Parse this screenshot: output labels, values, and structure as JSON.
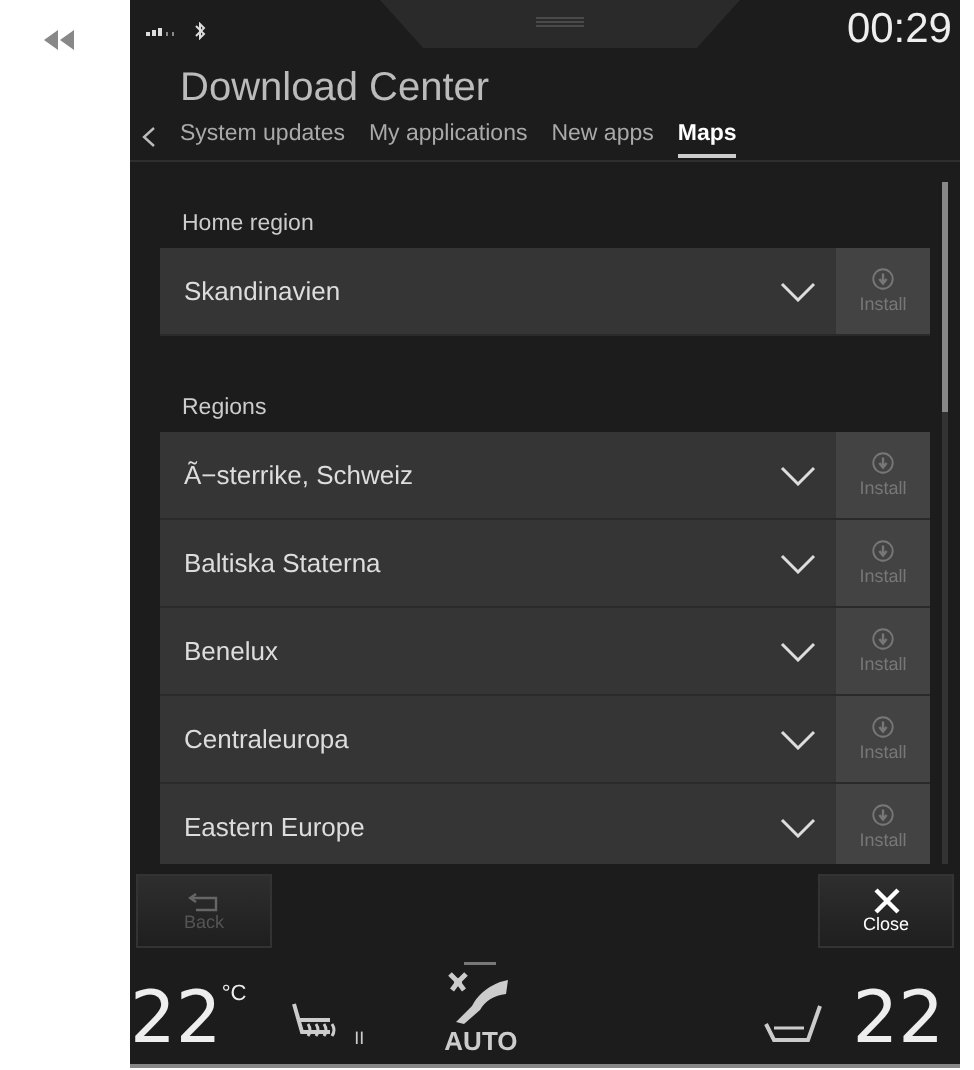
{
  "status_bar": {
    "time": "00:29"
  },
  "window": {
    "title": "Download Center"
  },
  "tabs": [
    {
      "label": "System updates",
      "selected": false
    },
    {
      "label": "My applications",
      "selected": false
    },
    {
      "label": "New apps",
      "selected": false
    },
    {
      "label": "Maps",
      "selected": true
    }
  ],
  "home_region": {
    "label": "Home region",
    "items": [
      {
        "name": "Skandinavien",
        "install": "Install",
        "disabled": true
      }
    ]
  },
  "regions": {
    "label": "Regions",
    "items": [
      {
        "name": "Ã−sterrike, Schweiz",
        "install": "Install",
        "disabled": true
      },
      {
        "name": "Baltiska Staterna",
        "install": "Install",
        "disabled": true
      },
      {
        "name": "Benelux",
        "install": "Install",
        "disabled": true
      },
      {
        "name": "Centraleuropa",
        "install": "Install",
        "disabled": true
      },
      {
        "name": "Eastern Europe",
        "install": "Install",
        "disabled": true
      }
    ]
  },
  "buttons": [
    {
      "kind": "back",
      "label": "Back",
      "disabled": true
    },
    {
      "kind": "close",
      "label": "Close",
      "disabled": false
    }
  ],
  "climate": {
    "left_temp": "22",
    "unit": "°C",
    "seat_heat_level": "II",
    "mode": "AUTO",
    "right_temp": "22"
  }
}
